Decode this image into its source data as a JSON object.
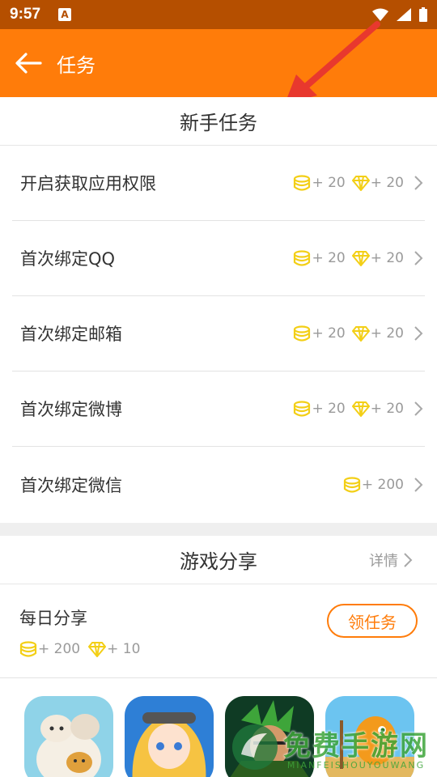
{
  "status_bar": {
    "time": "9:57",
    "notification_letter": "A",
    "icons": [
      "wifi-icon",
      "signal-icon",
      "battery-icon"
    ]
  },
  "app_bar": {
    "title": "任务",
    "color": "#ff7c0a"
  },
  "newbie_tasks": {
    "header": "新手任务",
    "items": [
      {
        "name": "开启获取应用权限",
        "coin": "+ 20",
        "diamond": "+ 20"
      },
      {
        "name": "首次绑定QQ",
        "coin": "+ 20",
        "diamond": "+ 20"
      },
      {
        "name": "首次绑定邮箱",
        "coin": "+ 20",
        "diamond": "+ 20"
      },
      {
        "name": "首次绑定微博",
        "coin": "+ 20",
        "diamond": "+ 20"
      },
      {
        "name": "首次绑定微信",
        "coin": "+ 200",
        "diamond": null
      }
    ]
  },
  "game_share": {
    "header": "游戏分享",
    "details_label": "详情",
    "daily": {
      "title": "每日分享",
      "coin": "+ 200",
      "diamond": "+ 10",
      "button_label": "领任务"
    },
    "games": [
      "game-cats",
      "game-anime-girl",
      "game-green-warrior",
      "game-digimon"
    ]
  },
  "watermark": {
    "cn": "免费手游网",
    "en": "MIANFEISHOUYOUWANG"
  }
}
